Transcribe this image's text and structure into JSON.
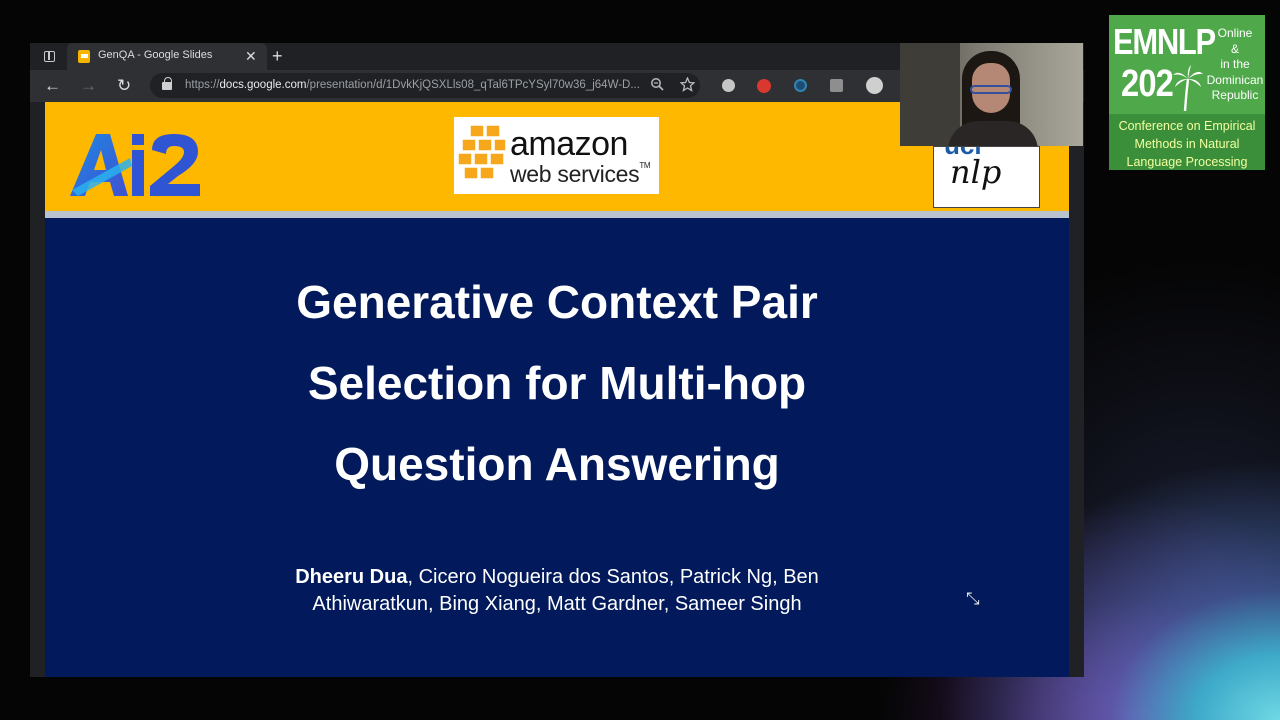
{
  "browser": {
    "tab": {
      "title": "GenQA - Google Slides",
      "close_label": "✕"
    },
    "new_tab_label": "+",
    "toolbar": {
      "back": "←",
      "forward": "→",
      "reload": "↻"
    },
    "url": {
      "host": "docs.google.com",
      "path": "/presentation/d/1DvkKjQSXLls08_qTal6TPcYSyl70w36_j64W-D...",
      "scheme": "https://"
    }
  },
  "slide": {
    "logos": {
      "ai2": "Ai2",
      "aws_main": "amazon",
      "aws_sub": "web services",
      "aws_tm": "TM",
      "uci_partial": "uci",
      "uci_nlp": "nlp"
    },
    "title_lines": [
      "Generative Context Pair",
      "Selection for Multi-hop",
      "Question Answering"
    ],
    "authors": {
      "first": "Dheeru Dua",
      "rest_line1": ", Cicero Nogueira dos Santos, Patrick Ng, Ben",
      "line2": "Athiwaratkun, Bing Xiang, Matt Gardner, Sameer Singh"
    },
    "header_color": "#FFB800",
    "background_color": "#021A5B"
  },
  "conference": {
    "name": "EMNLP",
    "year": "202",
    "location_lines": [
      "Online",
      "&",
      "in the",
      "Dominican",
      "Republic"
    ],
    "full_name_lines": [
      "Conference on Empirical",
      "Methods in Natural",
      "Language Processing"
    ]
  }
}
